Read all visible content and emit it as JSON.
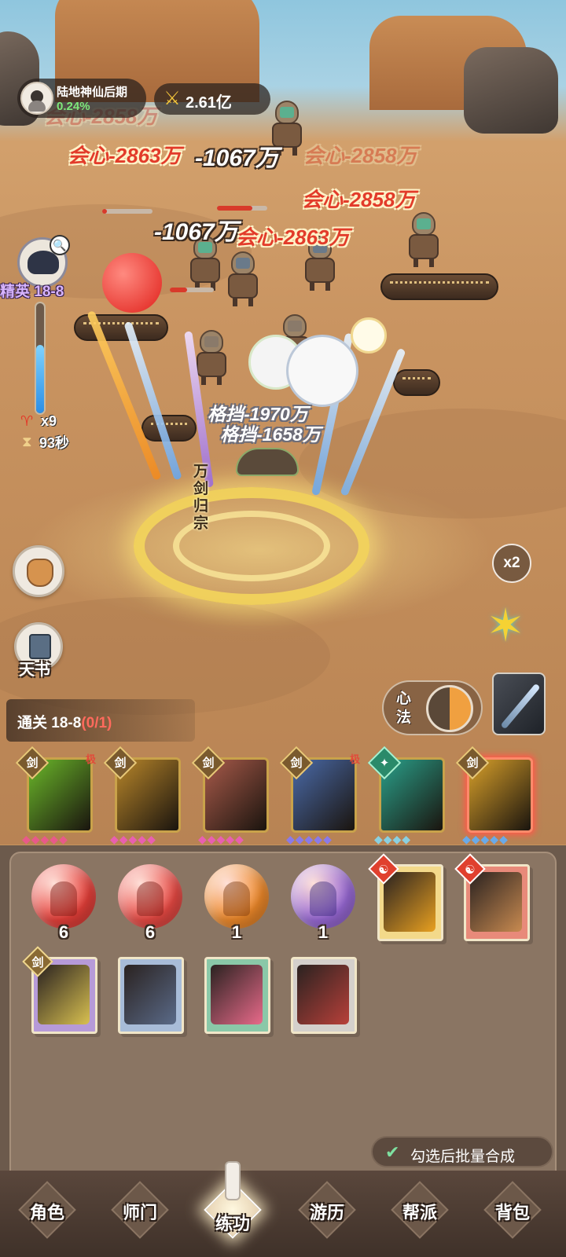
{
  "hud": {
    "rank_name": "陆地神仙后期",
    "rank_progress": "0.24%",
    "combat_power": "2.61亿"
  },
  "stage": {
    "label": "精英 18-8",
    "progress_fraction": 0.62,
    "demon_count": "x9",
    "timer": "93秒"
  },
  "battle": {
    "crit_texts": [
      "会心-2858万",
      "会心-2863万",
      "会心-2858万",
      "会心-2863万",
      "会心-2858万"
    ],
    "hit_texts": [
      "-1067万",
      "-1067万"
    ],
    "block_texts": [
      "格挡-1970万",
      "格挡-1658万"
    ],
    "skill_name": "万剑归宗"
  },
  "left_menu": {
    "book_label": "天书"
  },
  "right_menu": {
    "speed_label": "x2",
    "xinfa_label": "心法"
  },
  "quest": {
    "label": "通关 18-8",
    "progress": "(0/1)"
  },
  "skills": [
    {
      "name": "green",
      "color": "#6bb82a",
      "tier": "极",
      "badge": "剑"
    },
    {
      "name": "gold-blades",
      "color": "#b8862a",
      "tier": "",
      "badge": "剑"
    },
    {
      "name": "pink-slash",
      "color": "#a85a4a",
      "tier": "",
      "badge": "剑"
    },
    {
      "name": "comet",
      "color": "#4a6aa8",
      "tier": "极",
      "badge": "剑"
    },
    {
      "name": "teal-chains",
      "color": "#2aa08a",
      "tier": "",
      "badge": "✦"
    },
    {
      "name": "gold-burst",
      "color": "#d8a02a",
      "tier": "",
      "badge": "剑"
    }
  ],
  "inventory": {
    "orbs": [
      {
        "count": "6",
        "color": "#e8403a"
      },
      {
        "count": "6",
        "color": "#ea4a44"
      },
      {
        "count": "1",
        "color": "#f08a2a"
      },
      {
        "count": "1",
        "color": "#9a6ad8"
      }
    ],
    "books": [
      {
        "art": "#e8a020",
        "cover": "#f3d98a"
      },
      {
        "art": "#c88a50",
        "cover": "#e88a7a"
      },
      {
        "art": "#d8c050",
        "cover": "#b69ad8"
      },
      {
        "art": "#5a6a88",
        "cover": "#a8bcd8"
      },
      {
        "art": "#e86a8a",
        "cover": "#8ac8a8"
      },
      {
        "art": "#b8403a",
        "cover": "#d4d0cc"
      }
    ],
    "batch_label": "勾选后批量合成"
  },
  "nav": {
    "items": [
      "角色",
      "师门",
      "练功",
      "游历",
      "帮派",
      "背包"
    ]
  }
}
